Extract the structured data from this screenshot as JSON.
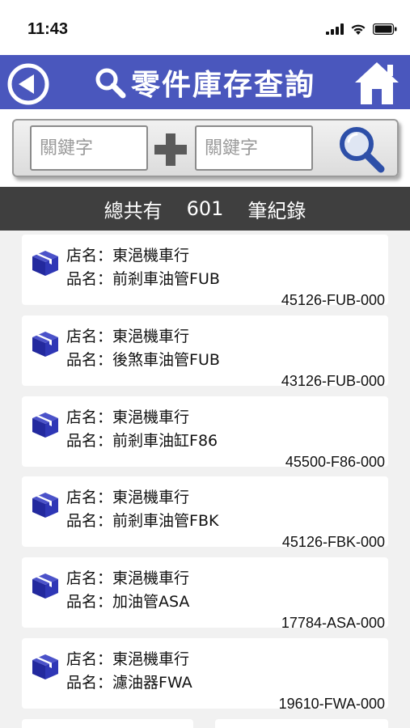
{
  "status": {
    "time": "11:43"
  },
  "nav": {
    "title": "零件庫存查詢"
  },
  "search": {
    "keyword1_placeholder": "關鍵字",
    "keyword2_placeholder": "關鍵字"
  },
  "summary": {
    "prefix": "總共有",
    "count": "601",
    "suffix": "筆紀錄"
  },
  "list": {
    "store_label": "店名：",
    "name_label": "品名：",
    "items": [
      {
        "store": "東浥機車行",
        "name": "前剎車油管FUB",
        "part_no": "45126-FUB-000"
      },
      {
        "store": "東浥機車行",
        "name": "後煞車油管FUB",
        "part_no": "43126-FUB-000"
      },
      {
        "store": "東浥機車行",
        "name": "前剎車油缸F86",
        "part_no": "45500-F86-000"
      },
      {
        "store": "東浥機車行",
        "name": "前剎車油管FBK",
        "part_no": "45126-FBK-000"
      },
      {
        "store": "東浥機車行",
        "name": "加油管ASA",
        "part_no": "17784-ASA-000"
      },
      {
        "store": "東浥機車行",
        "name": "濾油器FWA",
        "part_no": "19610-FWA-000"
      }
    ]
  },
  "colors": {
    "nav_bg": "#4a57bd",
    "count_bg": "#3f3f3f",
    "icon_blue": "#23299e"
  }
}
